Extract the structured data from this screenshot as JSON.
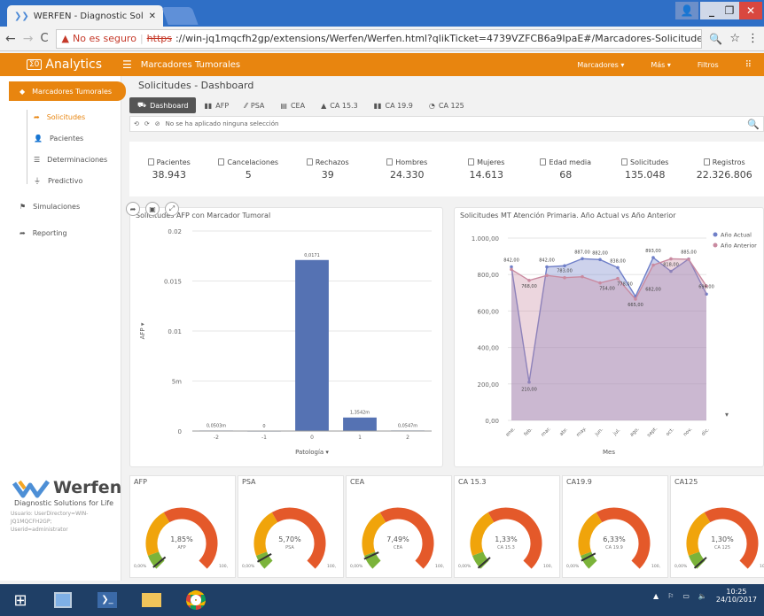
{
  "browser": {
    "tab_title": "WERFEN - Diagnostic Sol",
    "insecure_label": "No es seguro",
    "url_scheme": "https",
    "url_rest": "://win-jq1mqcfh2gp/extensions/Werfen/Werfen.html?qlikTicket=4739VZFCB6a9IpaE#/Marcadores-Solicitudes"
  },
  "app": {
    "logo_text": "Analytics",
    "sheet_name": "Marcadores Tumorales",
    "menu_marcadores": "Marcadores ▾",
    "menu_mas": "Más ▾",
    "menu_filtros": "Filtros",
    "accent": "#e8850f"
  },
  "sidebar": {
    "items": [
      {
        "label": "Marcadores Tumorales",
        "icon": "tag-icon"
      },
      {
        "label": "Solicitudes",
        "icon": "share-arrow-icon"
      },
      {
        "label": "Pacientes",
        "icon": "person-icon"
      },
      {
        "label": "Determinaciones",
        "icon": "list-icon"
      },
      {
        "label": "Predictivo",
        "icon": "funnel-icon"
      },
      {
        "label": "Simulaciones",
        "icon": "flag-icon"
      },
      {
        "label": "Reporting",
        "icon": "share-arrow-icon"
      }
    ]
  },
  "dashboard": {
    "title": "Solicitudes - Dashboard",
    "tabs": [
      "Dashboard",
      "AFP",
      "PSA",
      "CEA",
      "CA 15.3",
      "CA 19.9",
      "CA 125"
    ],
    "selection_text": "No se ha aplicado ninguna selección"
  },
  "kpis": [
    {
      "label": "Pacientes",
      "value": "38.943"
    },
    {
      "label": "Cancelaciones",
      "value": "5"
    },
    {
      "label": "Rechazos",
      "value": "39"
    },
    {
      "label": "Hombres",
      "value": "24.330"
    },
    {
      "label": "Mujeres",
      "value": "14.613"
    },
    {
      "label": "Edad media",
      "value": "68"
    },
    {
      "label": "Solicitudes",
      "value": "135.048"
    },
    {
      "label": "Registros",
      "value": "22.326.806"
    }
  ],
  "chart_data": [
    {
      "type": "bar",
      "title": "Solicitudes AFP con Marcador Tumoral",
      "xlabel": "Patología ▾",
      "ylabel": "AFP ▾",
      "categories": [
        "-2",
        "-1",
        "0",
        "1",
        "2"
      ],
      "values": [
        5.03e-05,
        0,
        0.0171,
        0.00135,
        5.47e-05
      ],
      "data_labels": [
        "0,0503m",
        "0",
        "0,0171",
        "1,3542m",
        "0,0547m"
      ],
      "y_ticks": [
        0,
        0.005,
        0.01,
        0.015,
        0.02
      ],
      "y_tick_labels": [
        "0",
        "5m",
        "0.01",
        "0.015",
        "0.02"
      ],
      "ylim": [
        0,
        0.02
      ],
      "color": "#5572b3",
      "grid": true
    },
    {
      "type": "line",
      "title": "Solicitudes MT Atención Primaria. Año Actual vs Año Anterior",
      "xlabel": "Mes",
      "categories": [
        "ene.",
        "feb.",
        "mar.",
        "abr.",
        "may.",
        "jun.",
        "jul.",
        "ago.",
        "sept.",
        "oct.",
        "nov.",
        "dic."
      ],
      "series": [
        {
          "name": "Año Actual",
          "values": [
            842,
            210,
            842,
            848,
            887,
            882,
            838,
            680,
            893,
            818,
            885,
            693
          ],
          "color": "#6f7fc8"
        },
        {
          "name": "Año Anterior",
          "values": [
            828,
            768,
            795,
            783,
            788,
            754,
            778,
            665,
            852,
            886,
            884,
            737
          ],
          "color": "#c98aa0"
        }
      ],
      "data_labels": [
        "842,00",
        "210,00",
        "842,00",
        "768,00",
        "783,00",
        "887,00",
        "882,00",
        "754,00",
        "838,00",
        "778,00",
        "682,00",
        "665,00",
        "893,00",
        "818,00",
        "885,00",
        "696,00"
      ],
      "y_ticks": [
        0,
        200,
        400,
        600,
        800,
        1000
      ],
      "y_tick_labels": [
        "0,00",
        "200,00",
        "400,00",
        "600,00",
        "800,00",
        "1.000,00"
      ],
      "ylim": [
        0,
        1000
      ],
      "legend": "top-right",
      "grid": true
    }
  ],
  "gauges": [
    {
      "title": "AFP",
      "value": "1,85%",
      "label": "AFP",
      "pct": 1.85,
      "min": "0,00%",
      "max": "100,"
    },
    {
      "title": "PSA",
      "value": "5,70%",
      "label": "PSA",
      "pct": 5.7,
      "min": "0,00%",
      "max": "100,"
    },
    {
      "title": "CEA",
      "value": "7,49%",
      "label": "CEA",
      "pct": 7.49,
      "min": "0,00%",
      "max": "100,"
    },
    {
      "title": "CA 15.3",
      "value": "1,33%",
      "label": "CA 15.3",
      "pct": 1.33,
      "min": "0,00%",
      "max": "100,"
    },
    {
      "title": "CA19.9",
      "value": "6,33%",
      "label": "CA 19.9",
      "pct": 6.33,
      "min": "0,00%",
      "max": "100,"
    },
    {
      "title": "CA125",
      "value": "1,30%",
      "label": "CA 125",
      "pct": 1.3,
      "min": "0,00%",
      "max": "100,"
    }
  ],
  "brand": {
    "name": "Werfen",
    "tagline": "Diagnostic Solutions for Life",
    "user_line1": "Usuario: UserDirectory=WIN-",
    "user_line2": "JQ1MQCFH2GP;",
    "user_line3": "Userid=administrator"
  },
  "taskbar": {
    "time": "10:25",
    "date": "24/10/2017"
  }
}
